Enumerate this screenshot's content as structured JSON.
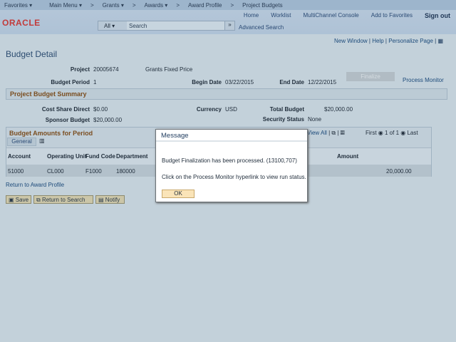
{
  "nav": {
    "items": [
      "Favorites ▾",
      "Main Menu ▾",
      ">",
      "Grants ▾",
      ">",
      "Awards ▾",
      ">",
      "Award Profile",
      ">",
      "Project Budgets"
    ]
  },
  "header": {
    "logo": "ORACLE",
    "links": [
      "Home",
      "Worklist",
      "MultiChannel Console",
      "Add to Favorites"
    ],
    "signout": "Sign out",
    "search_scope": "All",
    "search_placeholder": "Search",
    "advanced": "Advanced Search"
  },
  "pagelinks": {
    "new_window": "New Window",
    "help": "Help",
    "personalize": "Personalize Page"
  },
  "page": {
    "title": "Budget Detail",
    "project_label": "Project",
    "project": "20005674",
    "project_desc": "Grants Fixed Price",
    "period_label": "Budget Period",
    "period": "1",
    "begin_label": "Begin Date",
    "begin": "03/22/2015",
    "end_label": "End Date",
    "end": "12/22/2015",
    "finalize": "Finalize",
    "process_monitor": "Process Monitor",
    "summary_title": "Project Budget Summary",
    "csd_label": "Cost Share Direct",
    "csd": "$0.00",
    "currency_label": "Currency",
    "currency": "USD",
    "total_label": "Total Budget",
    "total": "$20,000.00",
    "sponsor_label": "Sponsor Budget",
    "sponsor": "$20,000.00",
    "security_label": "Security Status",
    "security": "None"
  },
  "grid": {
    "title": "Budget Amounts for Period",
    "view_all": "View All",
    "first": "First",
    "count": "1 of 1",
    "last": "Last",
    "tab": "General",
    "columns": [
      "Account",
      "Operating Unit",
      "Fund Code",
      "Department",
      "Amount"
    ],
    "row": [
      "51000",
      "CL000",
      "F1000",
      "180000",
      "20,000.00"
    ]
  },
  "return_link": "Return to Award Profile",
  "buttons": {
    "save": "Save",
    "return_search": "Return to Search",
    "notify": "Notify"
  },
  "modal": {
    "title": "Message",
    "line1": "Budget Finalization has been processed. (13100,707)",
    "line2": "Click on the Process Monitor hyperlink to view run status.",
    "ok": "OK"
  }
}
